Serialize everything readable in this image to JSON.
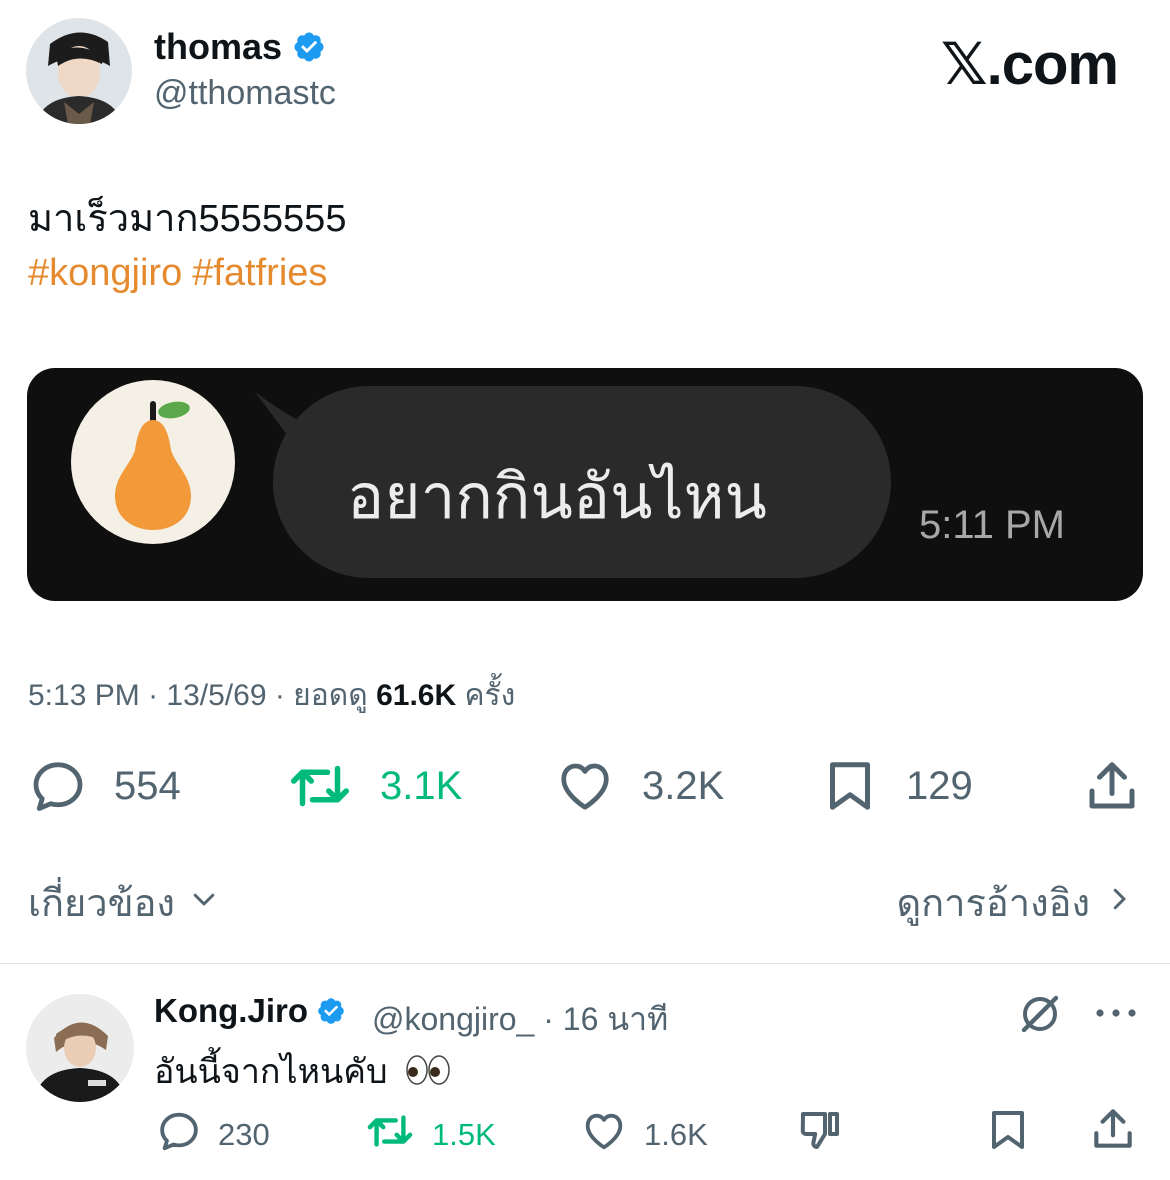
{
  "header": {
    "name": "thomas",
    "handle": "@tthomastc",
    "site": "𝕏.com"
  },
  "tweet": {
    "text": "มาเร็วมาก5555555",
    "hashtags": [
      "#kongjiro",
      "#fatfries"
    ]
  },
  "media": {
    "message": "อยากกินอันไหน",
    "time": "5:11 PM"
  },
  "meta": {
    "time": "5:13 PM",
    "date": "13/5/69",
    "views_label": "ยอดดู",
    "views": "61.6K",
    "views_suffix": "ครั้ง"
  },
  "actions": {
    "replies": "554",
    "reposts": "3.1K",
    "likes": "3.2K",
    "bookmarks": "129"
  },
  "links": {
    "related": "เกี่ยวข้อง",
    "quotes": "ดูการอ้างอิง"
  },
  "reply": {
    "name": "Kong.Jiro",
    "handle": "@kongjiro_ · 16 นาที",
    "text": "อันนี้จากไหนคับ",
    "replies": "230",
    "reposts": "1.5K",
    "likes": "1.6K"
  },
  "colors": {
    "hashtag": "#e58a2e",
    "repost": "#00ba7c",
    "verified": "#1d9bf0",
    "secondary": "#536471"
  },
  "icons": [
    "verified-icon",
    "reply-icon",
    "repost-icon",
    "like-icon",
    "bookmark-icon",
    "share-icon",
    "chevron-down-icon",
    "chevron-right-icon",
    "grok-icon",
    "more-icon",
    "dislike-icon",
    "pear-icon",
    "eyes-emoji"
  ]
}
